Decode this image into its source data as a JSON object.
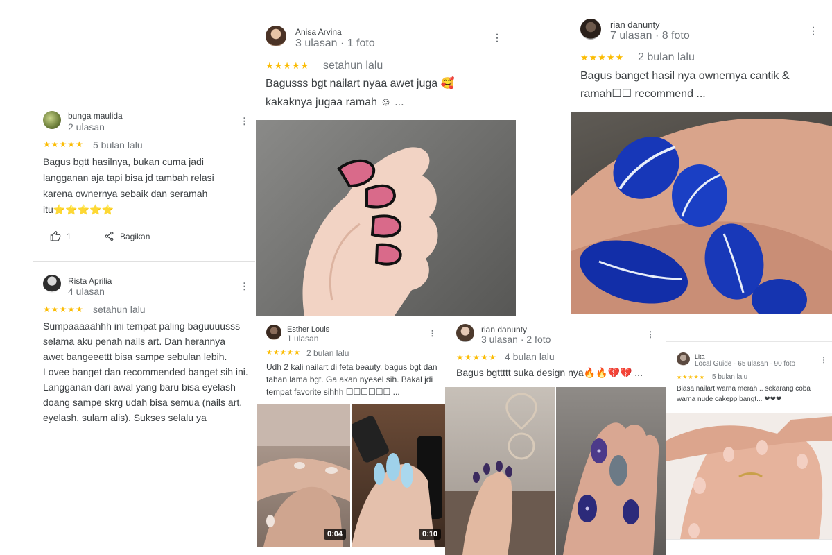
{
  "colors": {
    "star": "#fbbc04",
    "text": "#3c4043",
    "muted": "#70757a"
  },
  "icons": {
    "star": "star-icon",
    "more": "more-vert-icon",
    "like": "thumb-up-icon",
    "share": "share-icon",
    "heart": "heart-icon",
    "fire": "fire-icon"
  },
  "stars_glyph": "★★★★★",
  "more_glyph": "⋮",
  "reviews": {
    "bunga": {
      "name": "bunga maulida",
      "meta": "2 ulasan",
      "when": "5 bulan lalu",
      "text": "Bagus bgtt hasilnya, bukan cuma jadi langganan aja tapi bisa jd tambah relasi karena ownernya sebaik dan seramah itu",
      "trailing_emoji": "⭐⭐⭐⭐⭐",
      "like_count": "1",
      "share_label": "Bagikan"
    },
    "rista": {
      "name": "Rista Aprilia",
      "meta": "4 ulasan",
      "when": "setahun lalu",
      "text_1": "Sumpaaaaahhh ini tempat paling baguuuusss selama aku penah nails art. Dan herannya awet bangeeettt bisa sampe sebulan lebih.",
      "text_2": "Lovee banget dan recommended banget sih ini. Langganan dari awal yang baru bisa eyelash doang sampe skrg udah bisa semua (nails art, eyelash, sulam alis). Sukses selalu ya"
    },
    "anisa": {
      "name": "Anisa Arvina",
      "meta": "3 ulasan · 1 foto",
      "when": "setahun lalu",
      "text": "Bagusss bgt nailart nyaa awet juga 🥰 kakaknya jugaa ramah ☺ ..."
    },
    "rian1": {
      "name": "rian danunty",
      "meta": "7 ulasan · 8 foto",
      "when": "2 bulan lalu",
      "text": "Bagus banget hasil nya ownernya cantik & ramah☐☐ recommend ..."
    },
    "esther": {
      "name": "Esther Louis",
      "meta": "1 ulasan",
      "when": "2 bulan lalu",
      "text": "Udh 2 kali nailart di feta beauty, bagus bgt dan tahan lama bgt. Ga akan nyesel sih. Bakal jdi tempat favorite sihhh ☐☐☐☐☐☐ ...",
      "video_1": "0:04",
      "video_2": "0:10"
    },
    "rian2": {
      "name": "rian danunty",
      "meta": "3 ulasan · 2 foto",
      "when": "4 bulan lalu",
      "text": "Bagus bgttttt suka design nya🔥🔥💔💔 ..."
    },
    "lita": {
      "name": "Lita",
      "meta": "Local Guide · 65 ulasan · 90 foto",
      "when": "5 bulan lalu",
      "text": "Biasa nailart warna merah .. sekarang coba warna nude cakepp bangt... ❤❤❤"
    }
  }
}
